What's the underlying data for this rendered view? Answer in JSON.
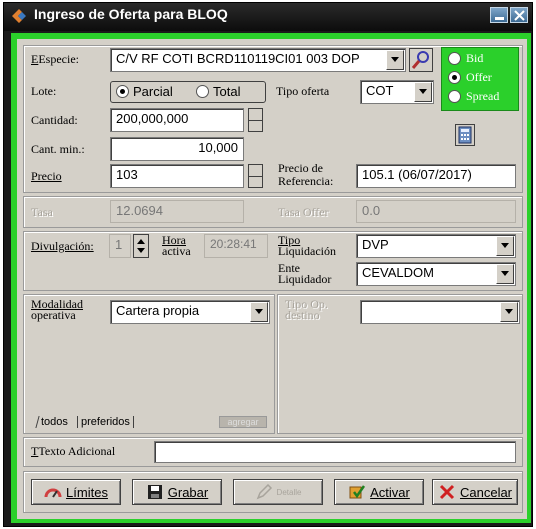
{
  "window": {
    "title": "Ingreso de Oferta para BLOQ"
  },
  "especie": {
    "label": "Especie:",
    "value": "C/V RF COTI BCRD110119CI01 003 DOP"
  },
  "side": {
    "options": [
      "Bid",
      "Offer",
      "Spread"
    ],
    "selected": "Offer"
  },
  "lote": {
    "label": "Lote:",
    "options": [
      "Parcial",
      "Total"
    ],
    "selected": "Parcial"
  },
  "tipo_oferta": {
    "label": "Tipo oferta",
    "value": "COT"
  },
  "cantidad": {
    "label": "Cantidad:",
    "value": "200,000,000"
  },
  "cant_min": {
    "label": "Cant. min.:",
    "value": "10,000"
  },
  "precio": {
    "label": "Precio",
    "value": "103"
  },
  "precio_ref": {
    "label_1": "Precio de",
    "label_2": "Referencia:",
    "value": "105.1 (06/07/2017)"
  },
  "tasa": {
    "label": "Tasa",
    "value": "12.0694"
  },
  "tasa_offer": {
    "label": "Tasa Offer",
    "value": "0.0"
  },
  "divulgacion": {
    "label": "Divulgación:",
    "value": "1"
  },
  "hora_activa": {
    "label_1": "Hora",
    "label_2": "activa",
    "value": "20:28:41"
  },
  "tipo_liquidacion": {
    "label_1": "Tipo",
    "label_2": "Liquidación",
    "value": "DVP"
  },
  "ente_liquidador": {
    "label_1": "Ente",
    "label_2": "Liquidador",
    "value": "CEVALDOM"
  },
  "modalidad": {
    "label_1": "Modalidad",
    "label_2": "operativa",
    "value": "Cartera propia"
  },
  "tipo_op_destino": {
    "label_1": "Tipo Op.",
    "label_2": "destino",
    "value": ""
  },
  "tabs": {
    "todos": "todos",
    "preferidos": "preferidos",
    "agregar": "agregar"
  },
  "texto_adicional": {
    "label": "Texto Adicional",
    "value": ""
  },
  "buttons": {
    "limites": "Límites",
    "grabar": "Grabar",
    "disabled": "Detalle",
    "activar": "Activar",
    "cancelar": "Cancelar"
  }
}
